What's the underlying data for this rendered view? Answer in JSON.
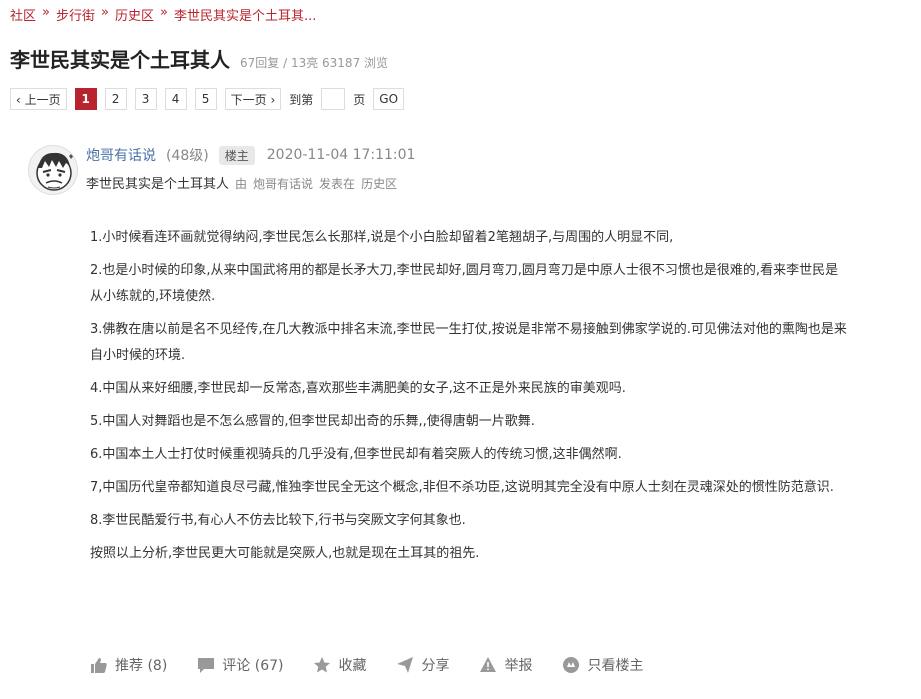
{
  "breadcrumb": {
    "items": [
      "社区",
      "步行街",
      "历史区",
      "李世民其实是个土耳其..."
    ],
    "separator": "»"
  },
  "thread": {
    "title": "李世民其实是个土耳其人",
    "stats": "67回复 / 13亮 63187 浏览"
  },
  "pager": {
    "prev": "‹ 上一页",
    "pages": [
      "1",
      "2",
      "3",
      "4",
      "5"
    ],
    "next": "下一页 ›",
    "goto_label": "到第",
    "page_suffix": "页",
    "go": "GO"
  },
  "post": {
    "author": "炮哥有话说",
    "level": "(48级)",
    "badge": "楼主",
    "datetime": "2020-11-04 17:11:01",
    "subject": "李世民其实是个土耳其人",
    "by": "由",
    "author_small": "炮哥有话说",
    "posted_in": "发表在",
    "board": "历史区"
  },
  "content": {
    "paragraphs": [
      "1.小时候看连环画就觉得纳闷,李世民怎么长那样,说是个小白脸却留着2笔翘胡子,与周围的人明显不同,",
      "2.也是小时候的印象,从来中国武将用的都是长矛大刀,李世民却好,圆月弯刀,圆月弯刀是中原人士很不习惯也是很难的,看来李世民是从小练就的,环境使然.",
      "3.佛教在唐以前是名不见经传,在几大教派中排名末流,李世民一生打仗,按说是非常不易接触到佛家学说的.可见佛法对他的熏陶也是来自小时候的环境.",
      "4.中国从来好细腰,李世民却一反常态,喜欢那些丰满肥美的女子,这不正是外来民族的审美观吗.",
      "5.中国人对舞蹈也是不怎么感冒的,但李世民却出奇的乐舞,,使得唐朝一片歌舞.",
      "6.中国本土人士打仗时候重视骑兵的几乎没有,但李世民却有着突厥人的传统习惯,这非偶然啊.",
      "7,中国历代皇帝都知道良尽弓藏,惟独李世民全无这个概念,非但不杀功臣,这说明其完全没有中原人士刻在灵魂深处的惯性防范意识.",
      "8.李世民酷爱行书,有心人不仿去比较下,行书与突厥文字何其象也.",
      "按照以上分析,李世民更大可能就是突厥人,也就是现在土耳其的祖先."
    ]
  },
  "actions": {
    "recommend": "推荐 (8)",
    "comment": "评论 (67)",
    "favorite": "收藏",
    "share": "分享",
    "report": "举报",
    "only_owner": "只看楼主"
  },
  "colors": {
    "accent": "#b8232e",
    "link": "#4a72a8"
  }
}
